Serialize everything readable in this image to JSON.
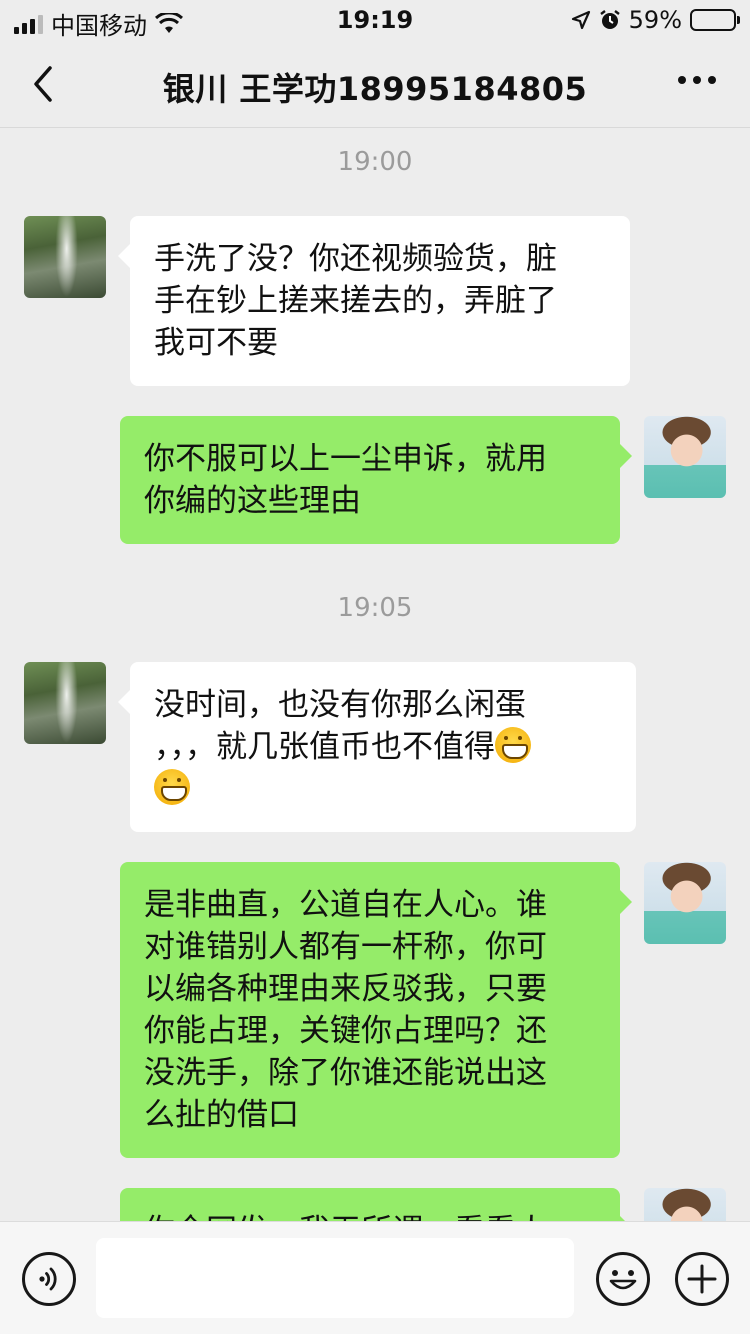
{
  "status_bar": {
    "carrier": "中国移动",
    "time": "19:19",
    "battery_percent": "59%",
    "battery_level": 0.59,
    "icons": [
      "signal-icon",
      "wifi-icon",
      "location-icon",
      "alarm-icon",
      "battery-icon"
    ]
  },
  "header": {
    "title": "银川  王学功18995184805",
    "back_icon": "chevron-left-icon",
    "more_icon": "more-icon"
  },
  "messages": [
    {
      "type": "timestamp",
      "text": "19:00"
    },
    {
      "type": "incoming",
      "avatar": "waterfall-avatar",
      "lines": [
        "手洗了没？你还视频验货，脏",
        "手在钞上搓来搓去的，弄脏了",
        "我可不要"
      ]
    },
    {
      "type": "outgoing",
      "avatar": "toddler-avatar",
      "lines": [
        "你不服可以上一尘申诉，就用",
        "你编的这些理由"
      ]
    },
    {
      "type": "timestamp",
      "text": "19:05"
    },
    {
      "type": "incoming",
      "avatar": "waterfall-avatar",
      "lines": [
        "没时间，也没有你那么闲蛋",
        "，，，就几张值币也不值得"
      ],
      "emoji": "grinning-emoji"
    },
    {
      "type": "outgoing",
      "avatar": "toddler-avatar",
      "lines": [
        "是非曲直，公道自在人心。谁",
        "对谁错别人都有一杆称，你可",
        "以编各种理由来反驳我，只要",
        "你能占理，关键你占理吗？还",
        "没洗手，除了你谁还能说出这",
        "么扯的借口"
      ]
    },
    {
      "type": "outgoing",
      "avatar": "toddler-avatar",
      "lines": [
        "你全网发，我无所谓，看看人"
      ]
    }
  ],
  "input_bar": {
    "voice_icon": "voice-icon",
    "emoji_icon": "emoji-icon",
    "plus_icon": "plus-icon",
    "text_value": ""
  },
  "colors": {
    "background": "#ededed",
    "outgoing_bubble": "#95ec69",
    "incoming_bubble": "#ffffff",
    "timestamp_text": "#9b9b9b"
  }
}
